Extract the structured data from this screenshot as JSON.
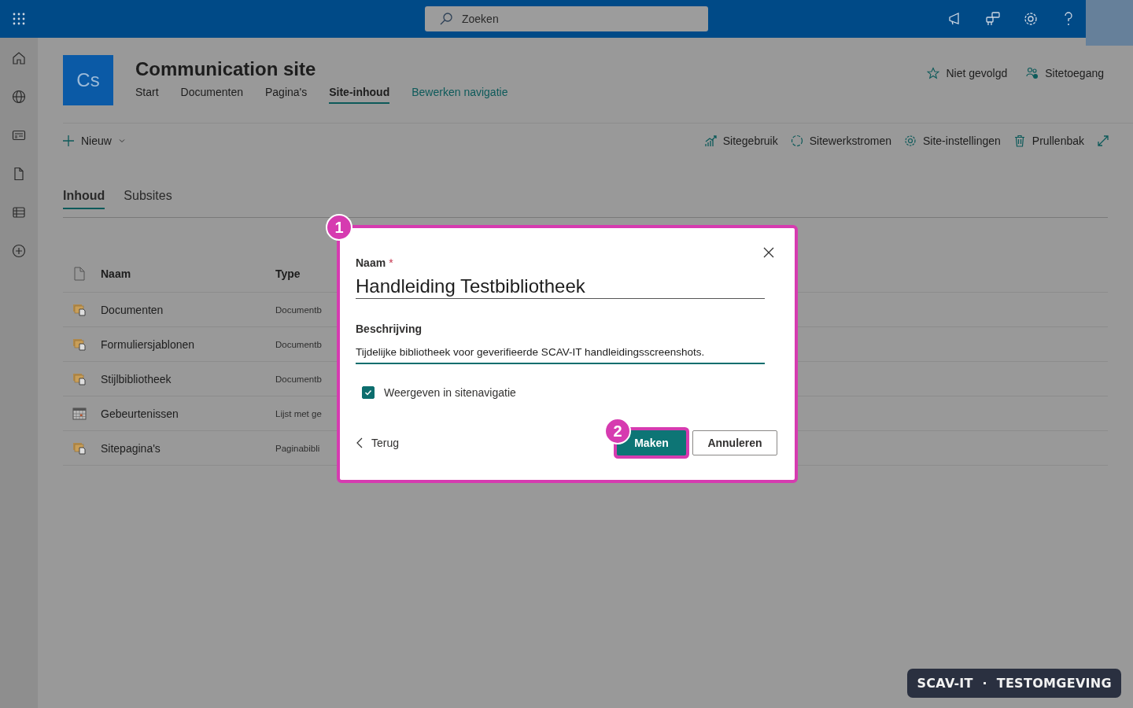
{
  "top_bar": {
    "search": {
      "placeholder": "Zoeken"
    },
    "icons": [
      {
        "kind": "megaphone"
      },
      {
        "kind": "chat"
      },
      {
        "kind": "settings"
      },
      {
        "kind": "help"
      }
    ]
  },
  "left_rail": [
    {
      "kind": "home"
    },
    {
      "kind": "globe"
    },
    {
      "kind": "news"
    },
    {
      "kind": "file"
    },
    {
      "kind": "list"
    },
    {
      "kind": "add"
    }
  ],
  "site": {
    "logo": "Cs",
    "title": "Communication site",
    "nav": [
      {
        "label": "Start",
        "selected": false
      },
      {
        "label": "Documenten",
        "selected": false
      },
      {
        "label": "Pagina's",
        "selected": false
      },
      {
        "label": "Site-inhoud",
        "selected": true
      }
    ],
    "edit_nav": "Bewerken navigatie",
    "actions": [
      {
        "kind": "star",
        "label": "Niet gevolgd"
      },
      {
        "kind": "people",
        "label": "Sitetoegang"
      }
    ]
  },
  "command_bar": {
    "new": "Nieuw",
    "actions": [
      {
        "kind": "chart",
        "label": "Sitegebruik"
      },
      {
        "kind": "flow",
        "label": "Sitewerkstromen"
      },
      {
        "kind": "settings",
        "label": "Site-instellingen"
      },
      {
        "kind": "trash",
        "label": "Prullenbak"
      }
    ]
  },
  "content_tabs": [
    {
      "label": "Inhoud",
      "selected": true
    },
    {
      "label": "Subsites",
      "selected": false
    }
  ],
  "table": {
    "columns": [
      "Naam",
      "Type"
    ],
    "rows": [
      {
        "kind": "library",
        "name": "Documenten",
        "type": "Documentb"
      },
      {
        "kind": "library",
        "name": "Formuliersjablonen",
        "type": "Documentb"
      },
      {
        "kind": "library",
        "name": "Stijlbibliotheek",
        "type": "Documentb"
      },
      {
        "kind": "calendar",
        "name": "Gebeurtenissen",
        "type": "Lijst met ge"
      },
      {
        "kind": "library",
        "name": "Sitepagina's",
        "type": "Paginabibli"
      }
    ]
  },
  "dialog": {
    "callout": "1",
    "name_label": "Naam",
    "required_mark": "*",
    "name_value": "Handleiding Testbibliotheek",
    "description_label": "Beschrijving",
    "description_value": "Tijdelijke bibliotheek voor geverifieerde SCAV-IT handleidingsscreenshots.",
    "checkbox": {
      "label": "Weergeven in sitenavigatie",
      "checked": true
    },
    "back": "Terug",
    "primary": {
      "label": "Maken",
      "callout": "2",
      "highlighted": true
    },
    "secondary": {
      "label": "Annuleren"
    }
  },
  "environment_badge": "SCAV-IT  ·  TESTOMGEVING"
}
